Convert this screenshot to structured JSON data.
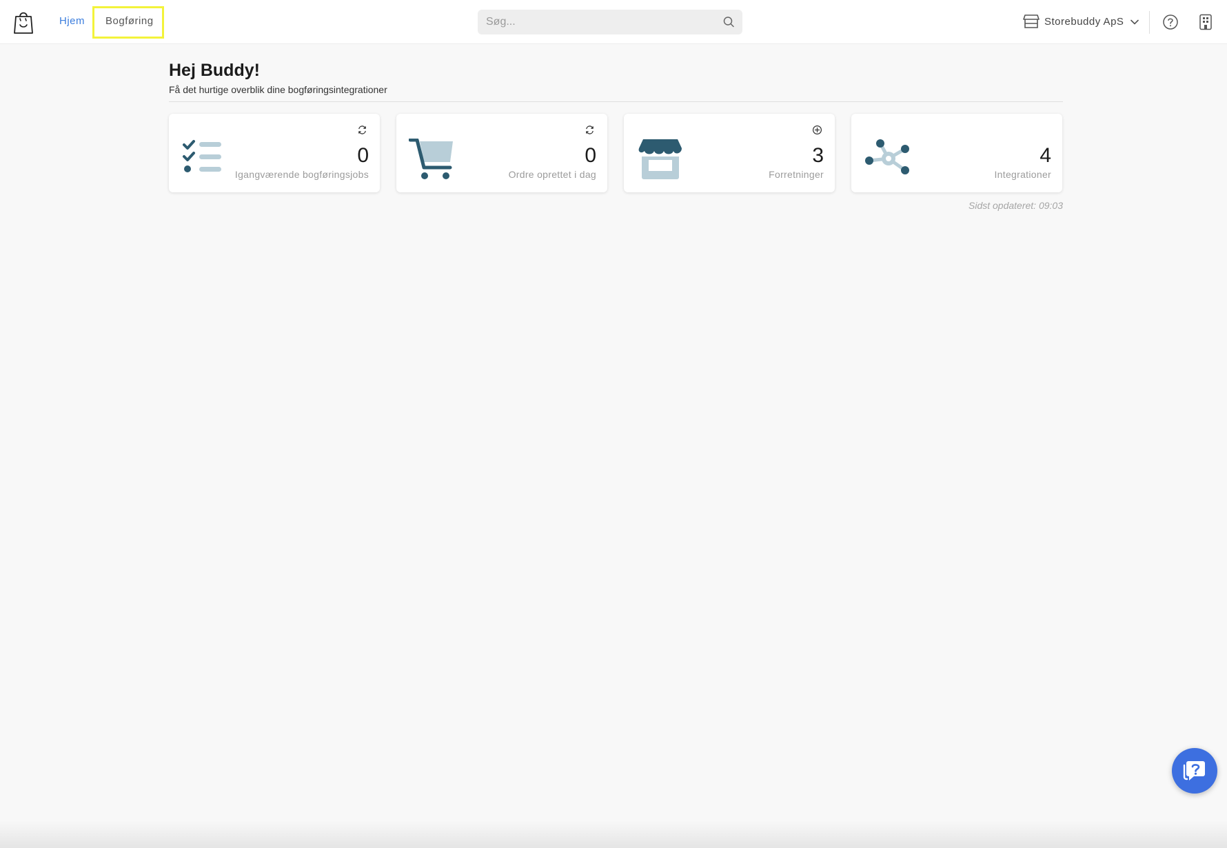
{
  "nav": {
    "home": "Hjem",
    "bookkeeping": "Bogføring"
  },
  "search": {
    "placeholder": "Søg..."
  },
  "company": {
    "name": "Storebuddy ApS"
  },
  "header": {
    "greeting": "Hej Buddy!",
    "subtitle": "Få det hurtige overblik dine bogføringsintegrationer"
  },
  "cards": [
    {
      "value": "0",
      "label": "Igangværende bogføringsjobs",
      "icon": "checklist-icon",
      "action_icon": "refresh-icon"
    },
    {
      "value": "0",
      "label": "Ordre oprettet i dag",
      "icon": "cart-icon",
      "action_icon": "refresh-icon"
    },
    {
      "value": "3",
      "label": "Forretninger",
      "icon": "store-icon",
      "action_icon": "plus-circle-icon"
    },
    {
      "value": "4",
      "label": "Integrationer",
      "icon": "network-icon",
      "action_icon": ""
    }
  ],
  "updated": "Sidst opdateret: 09:03",
  "colors": {
    "accent": "#3b7ddd",
    "icon_dark": "#2d5b70",
    "icon_light": "#b8ced8",
    "highlight": "#f3f33a",
    "chat_button": "#3d6fe0"
  }
}
